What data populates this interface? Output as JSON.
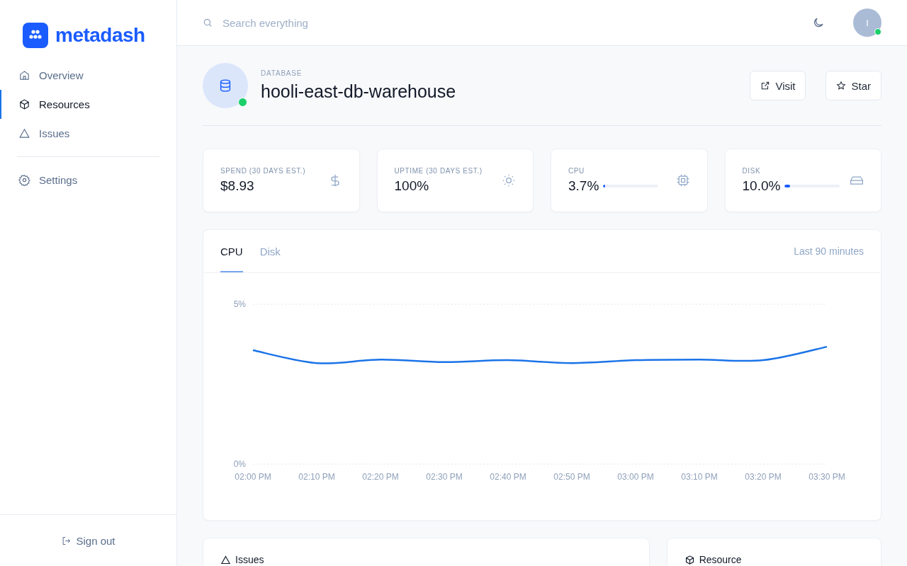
{
  "brand": {
    "name": "metadash"
  },
  "sidebar": {
    "items": [
      {
        "label": "Overview",
        "selected": false
      },
      {
        "label": "Resources",
        "selected": true
      },
      {
        "label": "Issues",
        "selected": false
      }
    ],
    "settings": {
      "label": "Settings",
      "selected": false
    },
    "sign_out": "Sign out"
  },
  "topbar": {
    "search": {
      "placeholder": "Search everything"
    },
    "avatar": {
      "initial": "I",
      "online": true
    }
  },
  "resource": {
    "type": "DATABASE",
    "name": "hooli-east-db-warehouse",
    "online": true,
    "buttons": [
      "Visit",
      "Star"
    ]
  },
  "stats": [
    {
      "kind": "text",
      "label": "SPEND (30 DAYS EST.)",
      "value": "$8.93"
    },
    {
      "kind": "text",
      "label": "UPTIME (30 DAYS EST.)",
      "value": "100%"
    },
    {
      "kind": "meter",
      "label": "CPU",
      "value": "3.7%",
      "level": 0.037
    },
    {
      "kind": "meter",
      "label": "DISK",
      "value": "10.0%",
      "level": 0.1
    }
  ],
  "chart_panel": {
    "tabs": [
      {
        "label": "CPU",
        "selected": true
      },
      {
        "label": "Disk",
        "selected": false
      }
    ],
    "range": "Last 90 minutes",
    "chart_data": {
      "type": "line",
      "categories": [
        "02:00 PM",
        "02:10 PM",
        "02:20 PM",
        "02:30 PM",
        "02:40 PM",
        "02:50 PM",
        "03:00 PM",
        "03:10 PM",
        "03:20 PM",
        "03:30 PM"
      ],
      "series": [
        {
          "color": "#1a73e8",
          "values": [
            3.56,
            3.16,
            3.27,
            3.19,
            3.25,
            3.16,
            3.25,
            3.27,
            3.25,
            3.67
          ]
        }
      ],
      "ylim": [
        0,
        5
      ],
      "yticks": [
        {
          "value": 0,
          "label": "0%"
        },
        {
          "value": 5,
          "label": "5%"
        }
      ]
    }
  },
  "bottom_cards": [
    {
      "title": "Issues"
    },
    {
      "title": "Resource"
    }
  ]
}
